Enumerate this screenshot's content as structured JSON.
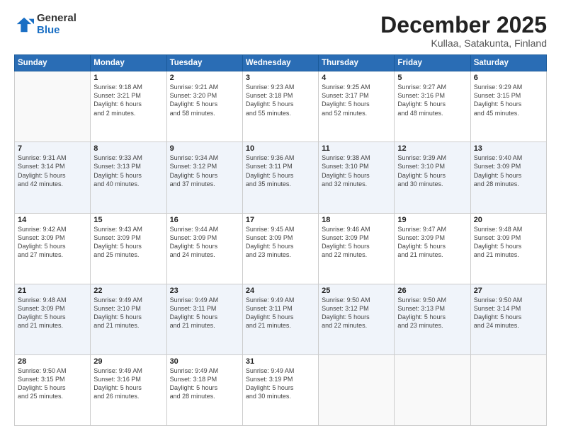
{
  "logo": {
    "general": "General",
    "blue": "Blue"
  },
  "title": {
    "month": "December 2025",
    "location": "Kullaa, Satakunta, Finland"
  },
  "weekdays": [
    "Sunday",
    "Monday",
    "Tuesday",
    "Wednesday",
    "Thursday",
    "Friday",
    "Saturday"
  ],
  "weeks": [
    [
      {
        "day": "",
        "info": ""
      },
      {
        "day": "1",
        "info": "Sunrise: 9:18 AM\nSunset: 3:21 PM\nDaylight: 6 hours\nand 2 minutes."
      },
      {
        "day": "2",
        "info": "Sunrise: 9:21 AM\nSunset: 3:20 PM\nDaylight: 5 hours\nand 58 minutes."
      },
      {
        "day": "3",
        "info": "Sunrise: 9:23 AM\nSunset: 3:18 PM\nDaylight: 5 hours\nand 55 minutes."
      },
      {
        "day": "4",
        "info": "Sunrise: 9:25 AM\nSunset: 3:17 PM\nDaylight: 5 hours\nand 52 minutes."
      },
      {
        "day": "5",
        "info": "Sunrise: 9:27 AM\nSunset: 3:16 PM\nDaylight: 5 hours\nand 48 minutes."
      },
      {
        "day": "6",
        "info": "Sunrise: 9:29 AM\nSunset: 3:15 PM\nDaylight: 5 hours\nand 45 minutes."
      }
    ],
    [
      {
        "day": "7",
        "info": "Sunrise: 9:31 AM\nSunset: 3:14 PM\nDaylight: 5 hours\nand 42 minutes."
      },
      {
        "day": "8",
        "info": "Sunrise: 9:33 AM\nSunset: 3:13 PM\nDaylight: 5 hours\nand 40 minutes."
      },
      {
        "day": "9",
        "info": "Sunrise: 9:34 AM\nSunset: 3:12 PM\nDaylight: 5 hours\nand 37 minutes."
      },
      {
        "day": "10",
        "info": "Sunrise: 9:36 AM\nSunset: 3:11 PM\nDaylight: 5 hours\nand 35 minutes."
      },
      {
        "day": "11",
        "info": "Sunrise: 9:38 AM\nSunset: 3:10 PM\nDaylight: 5 hours\nand 32 minutes."
      },
      {
        "day": "12",
        "info": "Sunrise: 9:39 AM\nSunset: 3:10 PM\nDaylight: 5 hours\nand 30 minutes."
      },
      {
        "day": "13",
        "info": "Sunrise: 9:40 AM\nSunset: 3:09 PM\nDaylight: 5 hours\nand 28 minutes."
      }
    ],
    [
      {
        "day": "14",
        "info": "Sunrise: 9:42 AM\nSunset: 3:09 PM\nDaylight: 5 hours\nand 27 minutes."
      },
      {
        "day": "15",
        "info": "Sunrise: 9:43 AM\nSunset: 3:09 PM\nDaylight: 5 hours\nand 25 minutes."
      },
      {
        "day": "16",
        "info": "Sunrise: 9:44 AM\nSunset: 3:09 PM\nDaylight: 5 hours\nand 24 minutes."
      },
      {
        "day": "17",
        "info": "Sunrise: 9:45 AM\nSunset: 3:09 PM\nDaylight: 5 hours\nand 23 minutes."
      },
      {
        "day": "18",
        "info": "Sunrise: 9:46 AM\nSunset: 3:09 PM\nDaylight: 5 hours\nand 22 minutes."
      },
      {
        "day": "19",
        "info": "Sunrise: 9:47 AM\nSunset: 3:09 PM\nDaylight: 5 hours\nand 21 minutes."
      },
      {
        "day": "20",
        "info": "Sunrise: 9:48 AM\nSunset: 3:09 PM\nDaylight: 5 hours\nand 21 minutes."
      }
    ],
    [
      {
        "day": "21",
        "info": "Sunrise: 9:48 AM\nSunset: 3:09 PM\nDaylight: 5 hours\nand 21 minutes."
      },
      {
        "day": "22",
        "info": "Sunrise: 9:49 AM\nSunset: 3:10 PM\nDaylight: 5 hours\nand 21 minutes."
      },
      {
        "day": "23",
        "info": "Sunrise: 9:49 AM\nSunset: 3:11 PM\nDaylight: 5 hours\nand 21 minutes."
      },
      {
        "day": "24",
        "info": "Sunrise: 9:49 AM\nSunset: 3:11 PM\nDaylight: 5 hours\nand 21 minutes."
      },
      {
        "day": "25",
        "info": "Sunrise: 9:50 AM\nSunset: 3:12 PM\nDaylight: 5 hours\nand 22 minutes."
      },
      {
        "day": "26",
        "info": "Sunrise: 9:50 AM\nSunset: 3:13 PM\nDaylight: 5 hours\nand 23 minutes."
      },
      {
        "day": "27",
        "info": "Sunrise: 9:50 AM\nSunset: 3:14 PM\nDaylight: 5 hours\nand 24 minutes."
      }
    ],
    [
      {
        "day": "28",
        "info": "Sunrise: 9:50 AM\nSunset: 3:15 PM\nDaylight: 5 hours\nand 25 minutes."
      },
      {
        "day": "29",
        "info": "Sunrise: 9:49 AM\nSunset: 3:16 PM\nDaylight: 5 hours\nand 26 minutes."
      },
      {
        "day": "30",
        "info": "Sunrise: 9:49 AM\nSunset: 3:18 PM\nDaylight: 5 hours\nand 28 minutes."
      },
      {
        "day": "31",
        "info": "Sunrise: 9:49 AM\nSunset: 3:19 PM\nDaylight: 5 hours\nand 30 minutes."
      },
      {
        "day": "",
        "info": ""
      },
      {
        "day": "",
        "info": ""
      },
      {
        "day": "",
        "info": ""
      }
    ]
  ]
}
